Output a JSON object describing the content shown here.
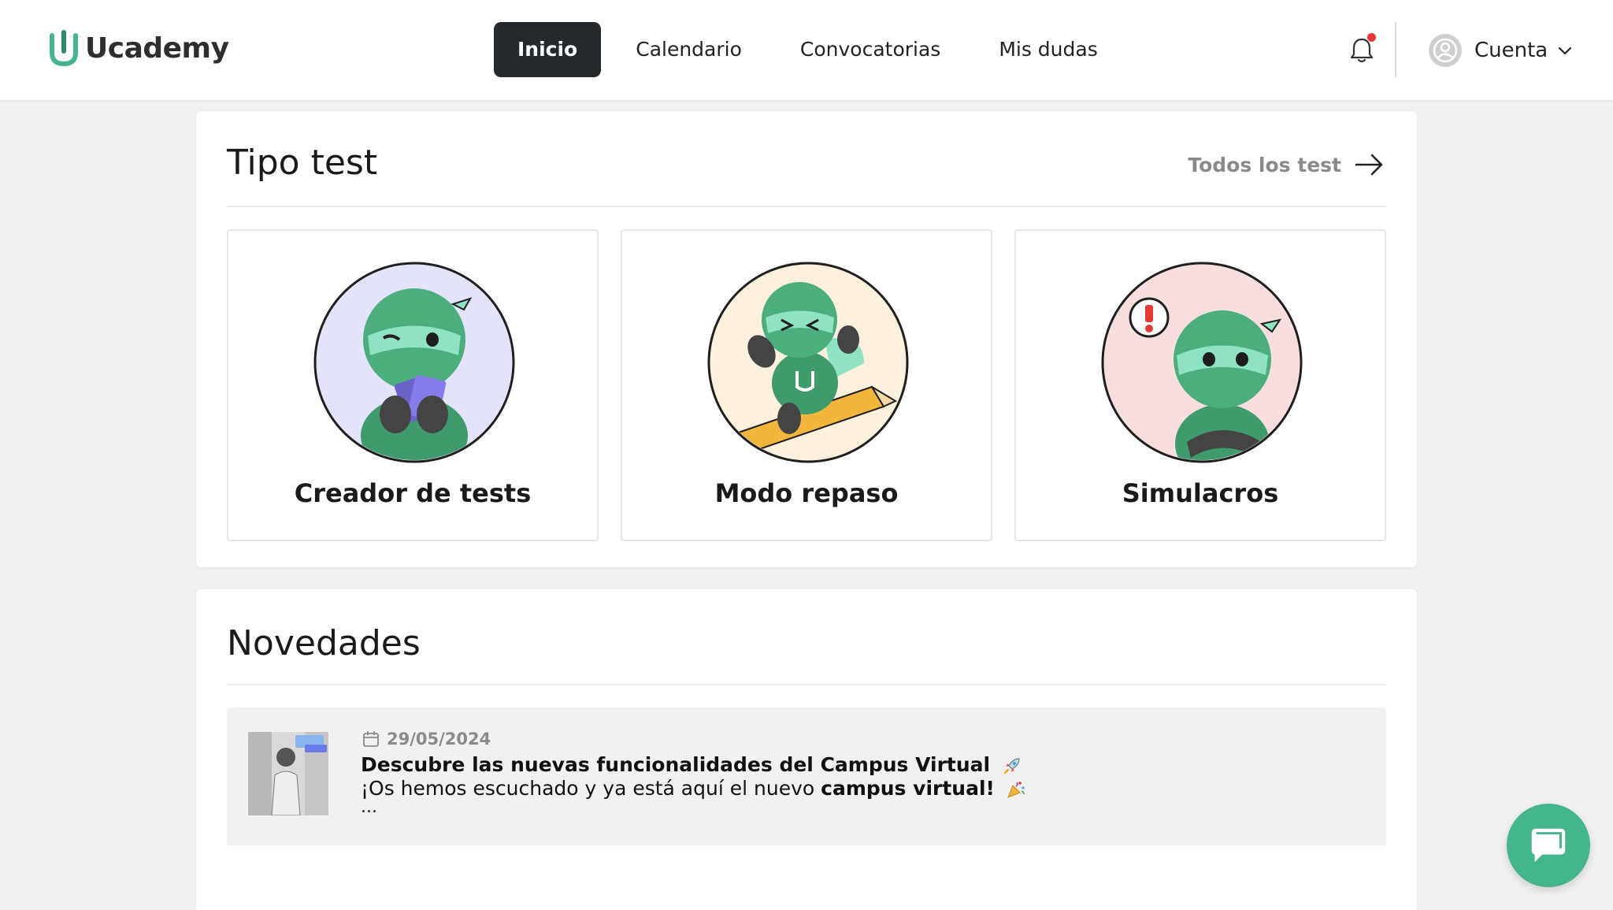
{
  "brand": {
    "name": "Ucademy",
    "accent": "#45b58b",
    "dark": "#23292d"
  },
  "nav": {
    "items": [
      {
        "label": "Inicio",
        "active": true
      },
      {
        "label": "Calendario",
        "active": false
      },
      {
        "label": "Convocatorias",
        "active": false
      },
      {
        "label": "Mis dudas",
        "active": false
      }
    ]
  },
  "header": {
    "notification_icon": "bell-icon",
    "has_unread": true,
    "account_label": "Cuenta"
  },
  "tipo_test": {
    "title": "Tipo test",
    "all_link": "Todos los test",
    "tiles": [
      {
        "label": "Creador de tests",
        "bg": "#e3e3fb"
      },
      {
        "label": "Modo repaso",
        "bg": "#fdf0dc"
      },
      {
        "label": "Simulacros",
        "bg": "#f9dede"
      }
    ]
  },
  "novedades": {
    "title": "Novedades",
    "items": [
      {
        "date": "29/05/2024",
        "title": "Descubre las nuevas funcionalidades del Campus Virtual",
        "body_prefix": "¡Os hemos escuchado y ya está aquí el nuevo ",
        "body_bold": "campus virtual!",
        "more": "..."
      }
    ]
  }
}
